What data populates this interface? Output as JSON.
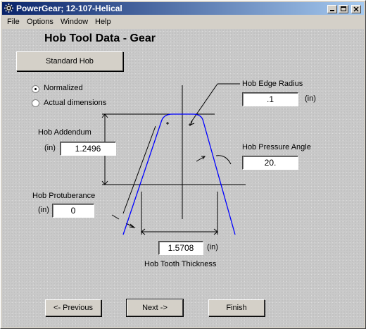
{
  "window": {
    "title": "PowerGear;  12-107-Helical"
  },
  "menu": [
    {
      "label": "File"
    },
    {
      "label": "Options"
    },
    {
      "label": "Window"
    },
    {
      "label": "Help"
    }
  ],
  "page": {
    "title": "Hob Tool Data - Gear",
    "standard_hob_button": "Standard Hob"
  },
  "mode": {
    "options": [
      {
        "label": "Normalized",
        "selected": true
      },
      {
        "label": "Actual dimensions",
        "selected": false
      }
    ]
  },
  "fields": {
    "edge_radius": {
      "label": "Hob Edge Radius",
      "unit": "(in)",
      "value": ".1"
    },
    "addendum": {
      "label": "Hob Addendum",
      "unit": "(in)",
      "value": "1.2496"
    },
    "pressure_angle": {
      "label": "Hob Pressure Angle",
      "value": "20."
    },
    "protuberance": {
      "label": "Hob Protuberance",
      "unit": "(in)",
      "value": "0"
    },
    "tooth_thickness": {
      "label": "Hob Tooth Thickness",
      "unit": "(in)",
      "value": "1.5708"
    }
  },
  "buttons": {
    "previous": "<- Previous",
    "next": "Next ->",
    "finish": "Finish"
  },
  "colors": {
    "title_bar_start": "#0a246a",
    "title_bar_end": "#a6caf0",
    "profile_line": "#0000ff",
    "dimension_line": "#000000"
  }
}
